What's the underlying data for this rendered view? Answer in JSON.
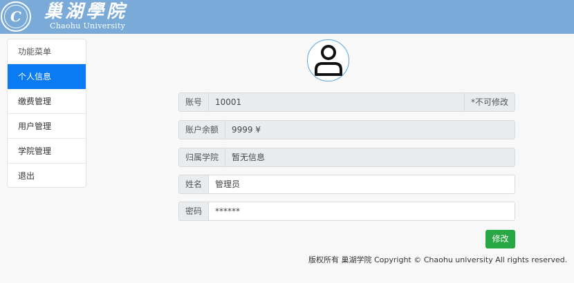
{
  "header": {
    "title_cn": "巢湖學院",
    "title_en": "Chaohu University",
    "seal_mark": "C"
  },
  "menu": {
    "items": [
      {
        "label": "功能菜单"
      },
      {
        "label": "个人信息"
      },
      {
        "label": "缴费管理"
      },
      {
        "label": "用户管理"
      },
      {
        "label": "学院管理"
      },
      {
        "label": "退出"
      }
    ]
  },
  "profile": {
    "avatar_icon": "user-icon",
    "account": {
      "label": "账号",
      "value": "10001",
      "note": "*不可修改"
    },
    "balance": {
      "label": "账户余额",
      "value": "9999 ¥"
    },
    "college": {
      "label": "归属学院",
      "value": "暂无信息"
    },
    "name": {
      "label": "姓名",
      "value": "管理员"
    },
    "password": {
      "label": "密码",
      "value": "******"
    },
    "submit_label": "修改"
  },
  "footer": {
    "text": "版权所有 巢湖学院 Copyright © Chaohu university All rights reserved."
  },
  "colors": {
    "header_bg": "#7aaad8",
    "active_menu": "#0a7bf2",
    "submit_bg": "#28a745"
  }
}
